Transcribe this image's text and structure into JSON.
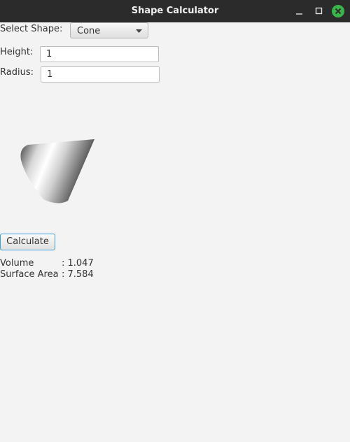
{
  "window": {
    "title": "Shape Calculator",
    "colors": {
      "titlebar": "#2b2b2b",
      "close": "#3ab54a",
      "background": "#f3f3f3"
    }
  },
  "form": {
    "shape_label": "Select Shape:",
    "shape_value": "Cone",
    "height_label": "Height:",
    "height_value": "1",
    "radius_label": "Radius:",
    "radius_value": "1"
  },
  "preview": {
    "shape_icon": "cone-icon"
  },
  "actions": {
    "calculate_label": "Calculate"
  },
  "results": {
    "volume_label": "Volume",
    "volume_value": ": 1.047",
    "surface_label": "Surface Area",
    "surface_value": ": 7.584"
  }
}
